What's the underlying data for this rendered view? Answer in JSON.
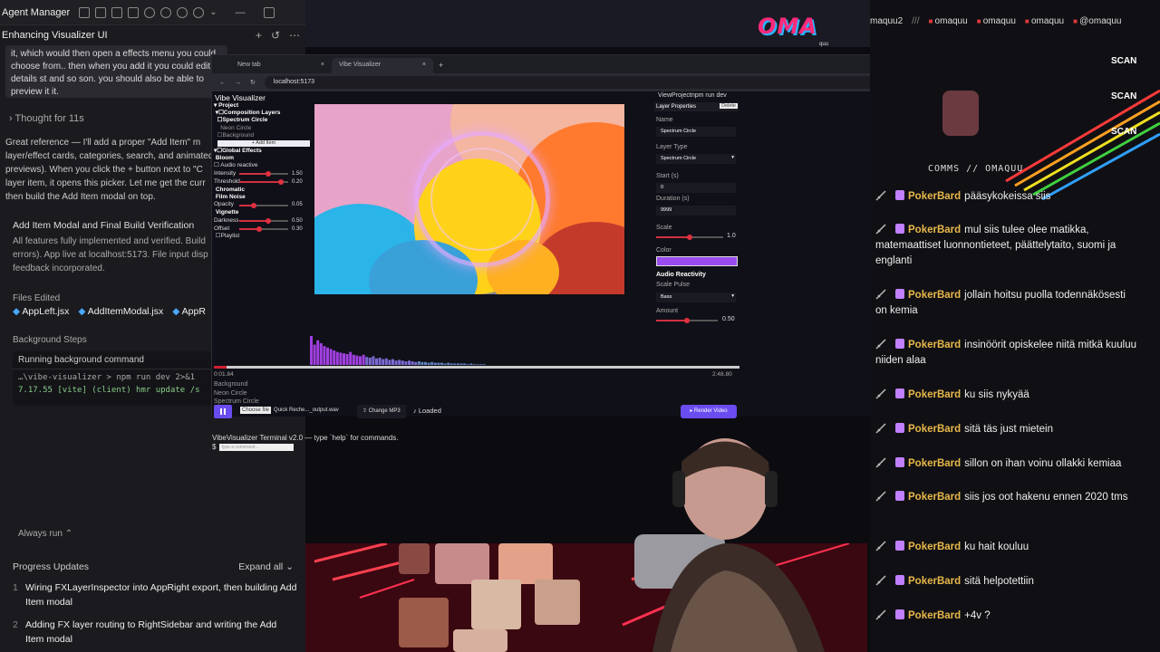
{
  "agent": {
    "title": "Agent Manager",
    "conversation_title": "Enhancing Visualizer UI",
    "prompt_text": "it, which would then open a effects menu you could choose from.. then when you add it you could edit its details st and so son. you should also be able to preview it it.",
    "thought_label": "Thought for 11s",
    "response_text": "Great reference — I'll add a proper \"Add Item\" m layer/effect cards, categories, search, and animated previews). When you click the + button next to \"C layer item, it opens this picker. Let me get the curr then build the Add Item modal on top.",
    "section_title": "Add Item Modal and Final Build Verification",
    "section_text": "All features fully implemented and verified. Build errors). App live at localhost:5173. File input disp feedback incorporated.",
    "files_label": "Files Edited",
    "files": [
      "AppLeft.jsx",
      "AddItemModal.jsx",
      "AppR"
    ],
    "bg_label": "Background Steps",
    "bg_header": "Running background command",
    "bg_line1": "…\\vibe-visualizer > npm run dev 2>&1",
    "bg_line2": "7.17.55 [vite] (client) hmr update /s",
    "always_run": "Always run",
    "progress_label": "Progress Updates",
    "expand_all": "Expand all",
    "progress_items": [
      {
        "num": "1",
        "text": "Wiring FXLayerInspector into AppRight export, then building Add Item modal"
      },
      {
        "num": "2",
        "text": "Adding FX layer routing to RightSidebar and writing the Add Item modal"
      }
    ]
  },
  "browser": {
    "tabs": [
      {
        "label": "New tab"
      },
      {
        "label": "Vibe Visualizer"
      }
    ],
    "url": "localhost:5173"
  },
  "vibe": {
    "app_title": "Vibe Visualizer",
    "tree": [
      "Project",
      "Composition Layers",
      "Spectrum Circle",
      "Neon Circle",
      "Background"
    ],
    "add_item": "+ Add Item",
    "global_effects": "Global Effects",
    "bloom": "Bloom",
    "audio_reactive": "Audio reactive",
    "fx": [
      {
        "label": "Intensity",
        "value": "1.50",
        "pos": 0.6
      },
      {
        "label": "Threshold",
        "value": "0.20",
        "pos": 0.85
      }
    ],
    "chromatic": "Chromatic",
    "film_noise": "Film Noise",
    "fx2": [
      {
        "label": "Opacity",
        "value": "0.05",
        "pos": 0.3
      }
    ],
    "vignette": "Vignette",
    "fx3": [
      {
        "label": "Darkness",
        "value": "0.50",
        "pos": 0.6
      },
      {
        "label": "Offset",
        "value": "0.30",
        "pos": 0.4
      }
    ],
    "playlist": "Playlist",
    "right": {
      "top": "ViewProjectnpm run dev",
      "header": "Layer Properties",
      "delete": "Delete",
      "name_label": "Name",
      "name_value": "Spectrum Circle",
      "type_label": "Layer Type",
      "type_value": "Spectrum Circle",
      "start_label": "Start (s)",
      "start_value": "0",
      "duration_label": "Duration (s)",
      "duration_value": "9999",
      "scale_label": "Scale",
      "scale_value": "1.0",
      "color_label": "Color",
      "color": "#9a4bf0",
      "audio_label": "Audio Reactivity",
      "pulse_label": "Scale Pulse",
      "pulse_value": "Bass",
      "amount_label": "Amount",
      "amount_value": "0.50"
    },
    "spectrum": [
      40,
      28,
      34,
      30,
      26,
      24,
      22,
      20,
      18,
      17,
      16,
      15,
      18,
      14,
      13,
      12,
      14,
      11,
      10,
      12,
      9,
      10,
      8,
      9,
      7,
      8,
      6,
      7,
      6,
      5,
      6,
      5,
      4,
      5,
      4,
      4,
      3,
      4,
      3,
      3,
      3,
      2,
      3,
      2,
      2,
      2,
      2,
      2,
      1,
      2,
      1,
      1,
      1,
      1
    ],
    "time_current": "0:01.84",
    "time_total": "2:48.80",
    "tracks": [
      "Background",
      "Neon Circle",
      "Spectrum Circle"
    ],
    "choose_file": "Choose file",
    "file_name": "Quick Reche..._output.wav",
    "change_mp3": "Change MP3",
    "loaded": "♪ Loaded",
    "render": "Render Video",
    "terminal_line": "VibeVisualizer Terminal v2.0 — type `help` for commands.",
    "terminal_prompt": "$",
    "terminal_placeholder": "type a command..."
  },
  "overlay": {
    "logo_text": "OMA",
    "logo_sub": "quu",
    "socials": [
      "maquu2",
      "///",
      "omaquu",
      "omaquu",
      "omaquu",
      "@omaquu"
    ],
    "scans": [
      "SCAN",
      "SCAN",
      "SCAN"
    ],
    "comms": "COMMS // OMAQUU"
  },
  "chat": [
    {
      "user": "PokerBard",
      "text": "pääsykokeissa siis"
    },
    {
      "user": "PokerBard",
      "text": "mul siis tulee olee matikka, matemaattiset luonnontieteet, päättelytaito, suomi ja englanti"
    },
    {
      "user": "PokerBard",
      "text": "jollain hoitsu puolla todennäkösesti on kemia"
    },
    {
      "user": "PokerBard",
      "text": "insinöörit opiskelee niitä mitkä kuuluu niiden alaa"
    },
    {
      "user": "PokerBard",
      "text": "ku siis nykyää"
    },
    {
      "user": "PokerBard",
      "text": "sitä täs just mietein"
    },
    {
      "user": "PokerBard",
      "text": "sillon on ihan voinu ollakki kemiaa"
    },
    {
      "user": "PokerBard",
      "text": "siis jos oot hakenu ennen 2020 tms"
    },
    {
      "user": "PokerBard",
      "text": "ku hait kouluu"
    },
    {
      "user": "PokerBard",
      "text": "sitä helpotettiin"
    },
    {
      "user": "PokerBard",
      "text": "+4v ?"
    }
  ]
}
